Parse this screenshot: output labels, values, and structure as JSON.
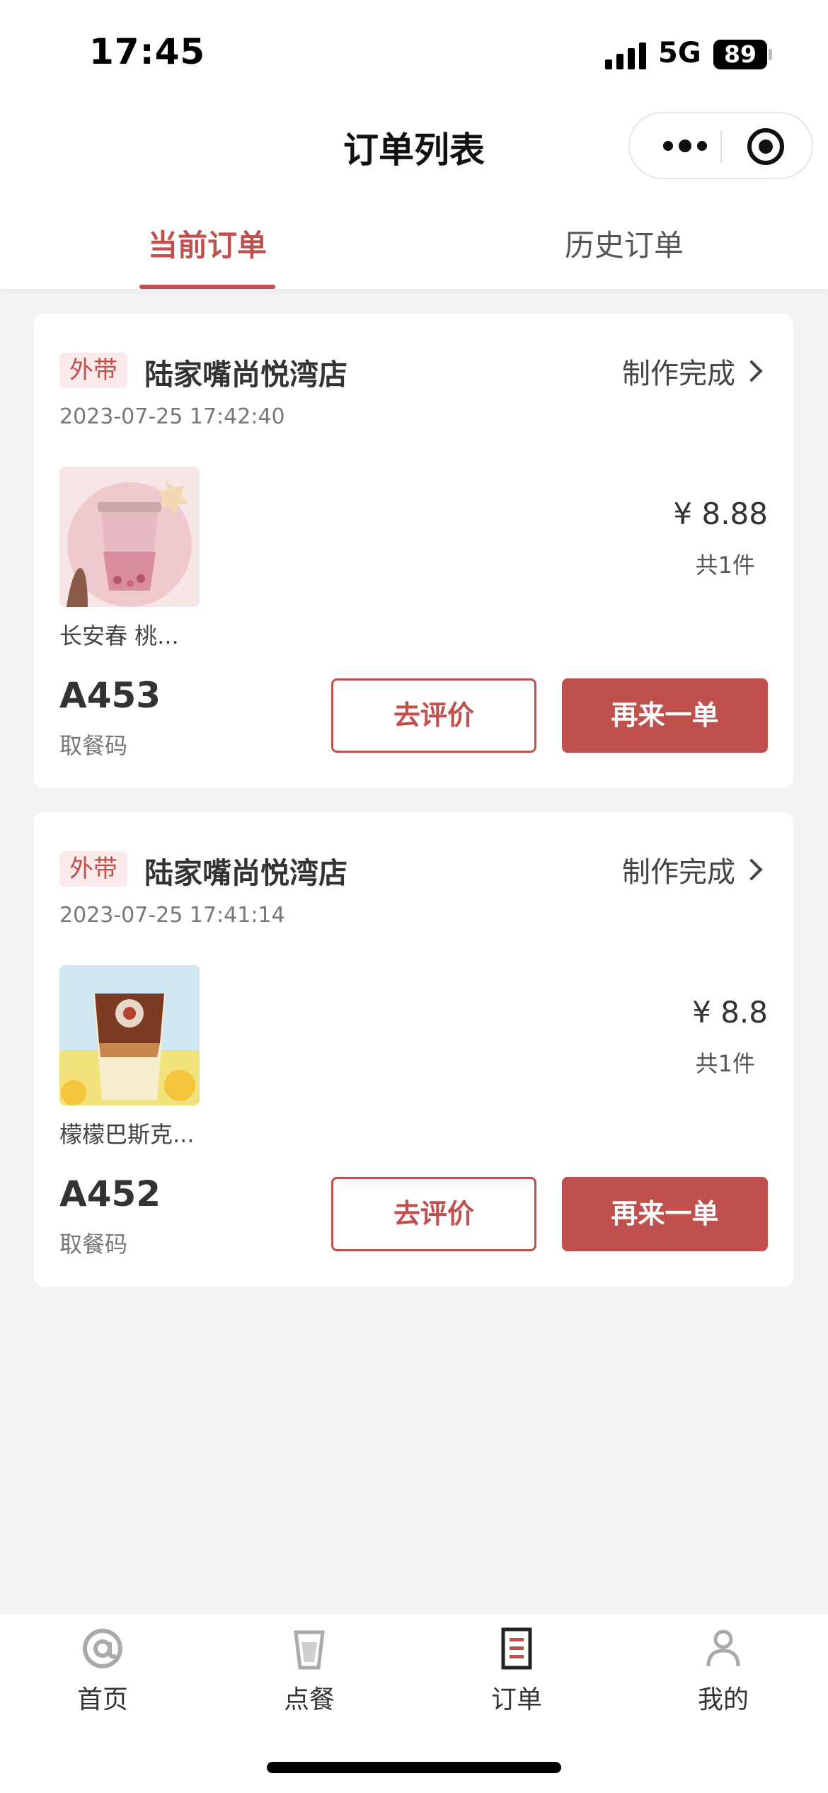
{
  "status_bar": {
    "time": "17:45",
    "network": "5G",
    "battery": "89"
  },
  "nav": {
    "title": "订单列表"
  },
  "tabs": [
    {
      "label": "当前订单",
      "active": true
    },
    {
      "label": "历史订单",
      "active": false
    }
  ],
  "orders": [
    {
      "type_badge": "外带",
      "store": "陆家嘴尚悦湾店",
      "status": "制作完成",
      "time": "2023-07-25 17:42:40",
      "item_name": "长安春 桃...",
      "price": "¥ 8.88",
      "count": "共1件",
      "pickup_code": "A453",
      "pickup_label": "取餐码",
      "review_label": "去评价",
      "reorder_label": "再来一单"
    },
    {
      "type_badge": "外带",
      "store": "陆家嘴尚悦湾店",
      "status": "制作完成",
      "time": "2023-07-25 17:41:14",
      "item_name": "檬檬巴斯克...",
      "price": "¥ 8.8",
      "count": "共1件",
      "pickup_code": "A452",
      "pickup_label": "取餐码",
      "review_label": "去评价",
      "reorder_label": "再来一单"
    }
  ],
  "tabbar": [
    {
      "label": "首页",
      "icon": "at-sign-icon",
      "active": false
    },
    {
      "label": "点餐",
      "icon": "cup-icon",
      "active": false
    },
    {
      "label": "订单",
      "icon": "receipt-icon",
      "active": true
    },
    {
      "label": "我的",
      "icon": "person-icon",
      "active": false
    }
  ],
  "colors": {
    "accent": "#c0504d",
    "badge_bg": "#fbeaea",
    "page_bg": "#f3f3f5"
  }
}
